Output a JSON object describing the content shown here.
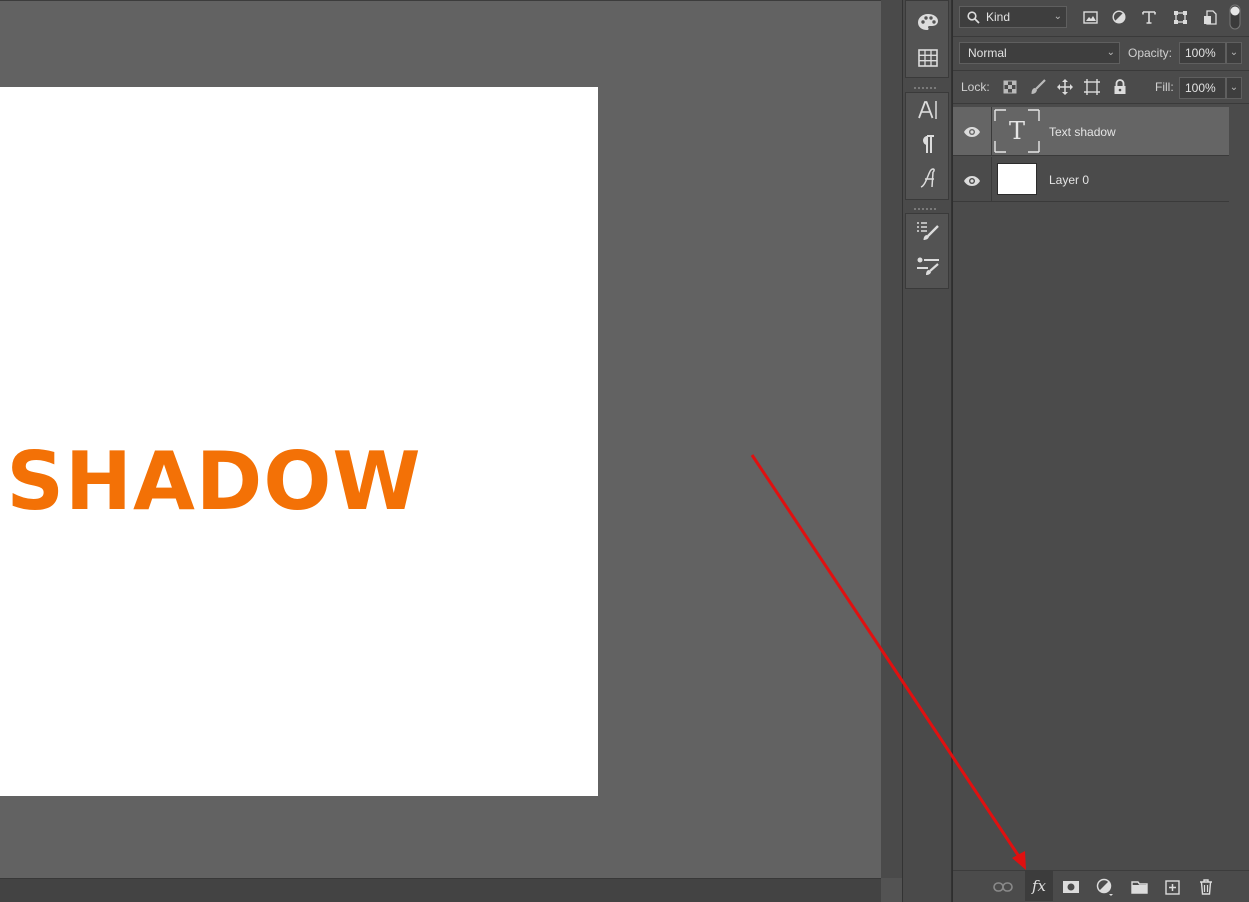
{
  "canvas": {
    "document_text": "T SHADOW",
    "text_color": "#f37106",
    "background": "#626262"
  },
  "icon_strip": {
    "tools": [
      {
        "name": "swatches",
        "icon": "palette-icon"
      },
      {
        "name": "patterns",
        "icon": "grid-icon"
      },
      {
        "name": "character",
        "icon": "character-icon"
      },
      {
        "name": "paragraph",
        "icon": "paragraph-icon"
      },
      {
        "name": "glyphs",
        "icon": "glyph-icon"
      },
      {
        "name": "brush-settings",
        "icon": "brush-settings-icon"
      },
      {
        "name": "tool-presets",
        "icon": "tool-presets-icon"
      }
    ]
  },
  "layers_panel": {
    "filter": {
      "kind_label": "Kind",
      "icons": [
        "image-filter-icon",
        "adjustment-filter-icon",
        "type-filter-icon",
        "shape-filter-icon",
        "smart-object-filter-icon",
        "filter-toggle-icon"
      ]
    },
    "blend_mode": "Normal",
    "opacity_label": "Opacity:",
    "opacity_value": "100%",
    "lock_label": "Lock:",
    "fill_label": "Fill:",
    "fill_value": "100%",
    "layers": [
      {
        "name": "Text shadow",
        "type": "text",
        "selected": true,
        "visible": true,
        "thumb_glyph": "T"
      },
      {
        "name": "Layer 0",
        "type": "pixel",
        "selected": false,
        "visible": true
      }
    ],
    "bottom_icons": [
      "link-layers-icon",
      "fx-icon",
      "layer-mask-icon",
      "adjustment-layer-icon",
      "group-folder-icon",
      "new-layer-icon",
      "delete-layer-icon"
    ],
    "fx_label": "fx"
  },
  "annotation": {
    "color": "#e01010"
  }
}
